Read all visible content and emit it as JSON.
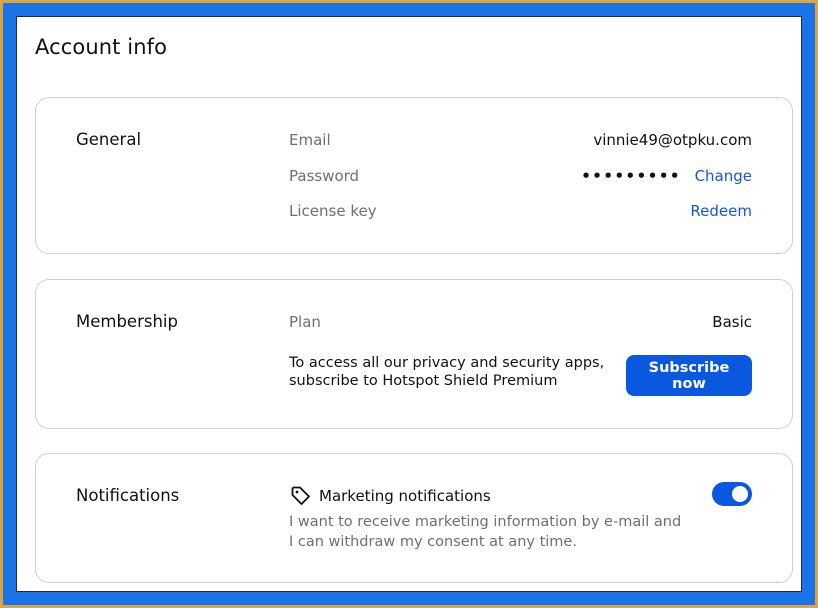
{
  "page": {
    "title": "Account info"
  },
  "general": {
    "title": "General",
    "email_label": "Email",
    "email_value": "vinnie49@otpku.com",
    "password_label": "Password",
    "password_value": "•••••••••",
    "password_action": "Change",
    "license_label": "License key",
    "license_action": "Redeem"
  },
  "membership": {
    "title": "Membership",
    "plan_label": "Plan",
    "plan_value": "Basic",
    "promo_text": "To access all our privacy and security apps, subscribe to Hotspot Shield Premium",
    "subscribe_label": "Subscribe now"
  },
  "notifications": {
    "title": "Notifications",
    "marketing_icon": "tag-icon",
    "marketing_title": "Marketing notifications",
    "marketing_description": "I want to receive marketing information by e-mail and I can withdraw my consent at any time.",
    "marketing_enabled": true
  },
  "colors": {
    "accent": "#0a57e0",
    "link": "#1357d6",
    "frame_outer": "#1b73e8",
    "frame_border": "#d9a441"
  }
}
